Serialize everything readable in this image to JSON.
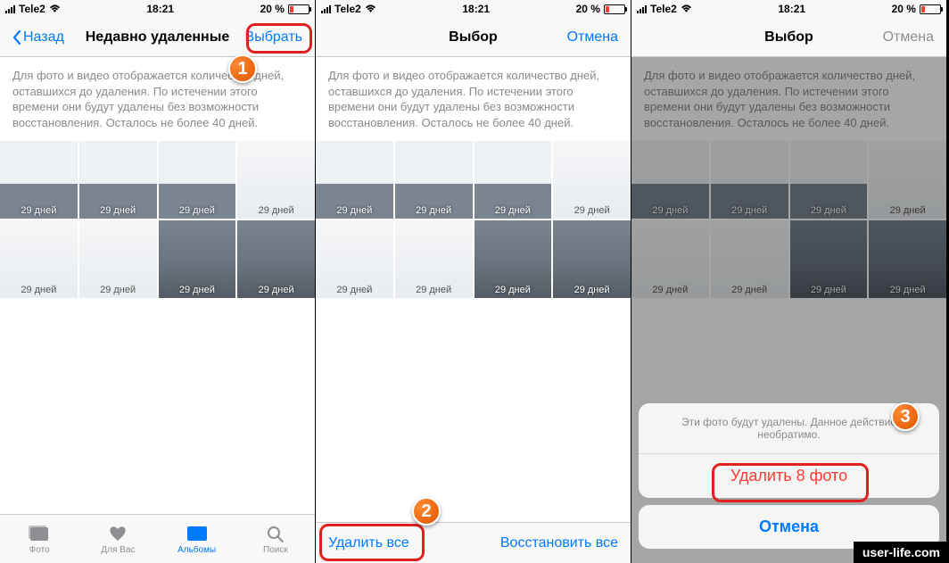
{
  "status": {
    "carrier": "Tele2",
    "time": "18:21",
    "battery_pct": "20 %"
  },
  "screen1": {
    "back": "Назад",
    "title": "Недавно удаленные",
    "select": "Выбрать",
    "info": "Для фото и видео отображается количество дней, оставшихся до удаления. По истечении этого времени они будут удалены без возможности восстановления. Осталось не более 40 дней.",
    "days": "29 дней",
    "tabs": {
      "photos": "Фото",
      "foryou": "Для Вас",
      "albums": "Альбомы",
      "search": "Поиск"
    }
  },
  "screen2": {
    "title": "Выбор",
    "cancel": "Отмена",
    "info": "Для фото и видео отображается количество дней, оставшихся до удаления. По истечении этого времени они будут удалены без возможности восстановления. Осталось не более 40 дней.",
    "days": "29 дней",
    "delete_all": "Удалить все",
    "restore_all": "Восстановить все"
  },
  "screen3": {
    "title": "Выбор",
    "cancel": "Отмена",
    "info": "Для фото и видео отображается количество дней, оставшихся до удаления. По истечении этого времени они будут удалены без возможности восстановления. Осталось не более 40 дней.",
    "days": "29 дней",
    "sheet_msg": "Эти фото будут удалены. Данное действие необратимо.",
    "delete_n": "Удалить 8 фото",
    "sheet_cancel": "Отмена"
  },
  "callouts": {
    "n1": "1",
    "n2": "2",
    "n3": "3"
  },
  "watermark": "user-life.com"
}
